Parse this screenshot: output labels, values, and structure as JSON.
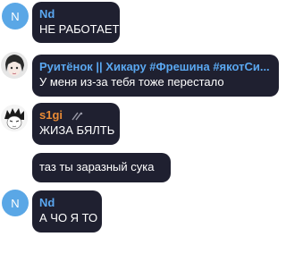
{
  "messages": [
    {
      "avatar_letter": "N",
      "sender": "Nd",
      "text": "НЕ РАБОТАЕТ"
    },
    {
      "sender": "Руитёнок || Хикару #Фрешина #якотСи...",
      "text": "У меня из-за тебя тоже перестало"
    },
    {
      "sender": "s1gi",
      "text": "ЖИЗА БЯЛТЬ"
    },
    {
      "text": "таз ты заразный сука"
    },
    {
      "avatar_letter": "N",
      "sender": "Nd",
      "text": "А ЧО Я ТО"
    }
  ],
  "colors": {
    "bubble": "#1f2030",
    "name_blue": "#5aa7f0",
    "name_orange": "#e88a35",
    "avatar": "#5aa7e6"
  }
}
